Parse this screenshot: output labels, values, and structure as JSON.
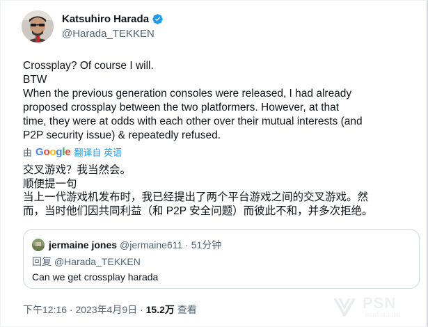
{
  "author": {
    "display_name": "Katsuhiro Harada",
    "handle": "@Harada_TEKKEN",
    "verified": true
  },
  "tweet": {
    "lines": [
      "Crossplay? Of course I will.",
      "BTW",
      "When the previous generation consoles were released, I had already",
      "proposed crossplay between the two platformers.  However, at that",
      "time, they were at odds with each other over their mutual interests (and",
      "P2P security issue) & repeatedly refused."
    ]
  },
  "translation": {
    "by_label": "由",
    "provider": "Google",
    "link_label": "翻译自 英语",
    "lines": [
      "交叉游戏？我当然会。",
      "顺便提一句",
      "当上一代游戏机发布时，我已经提出了两个平台游戏之间的交叉游戏。然",
      "而，当时他们因共同利益（和 P2P 安全问题）而彼此不和，并多次拒绝。"
    ]
  },
  "quote": {
    "display_name": "jermaine jones",
    "handle_time": "@jermaine611 · 51分钟",
    "reply_to": "回复 @Harada_TEKKEN",
    "text": "Can we get crossplay harada"
  },
  "meta": {
    "timestamp": "下午12:16 · 2023年4月9日 · ",
    "views": "15.2万",
    "views_label": " 查看"
  },
  "watermark": {
    "brand": "PSN",
    "sub": "psnine.com"
  },
  "colors": {
    "text": "#0f1419",
    "secondary": "#536471",
    "link": "#1d9bf0",
    "border": "#cfd9de"
  }
}
